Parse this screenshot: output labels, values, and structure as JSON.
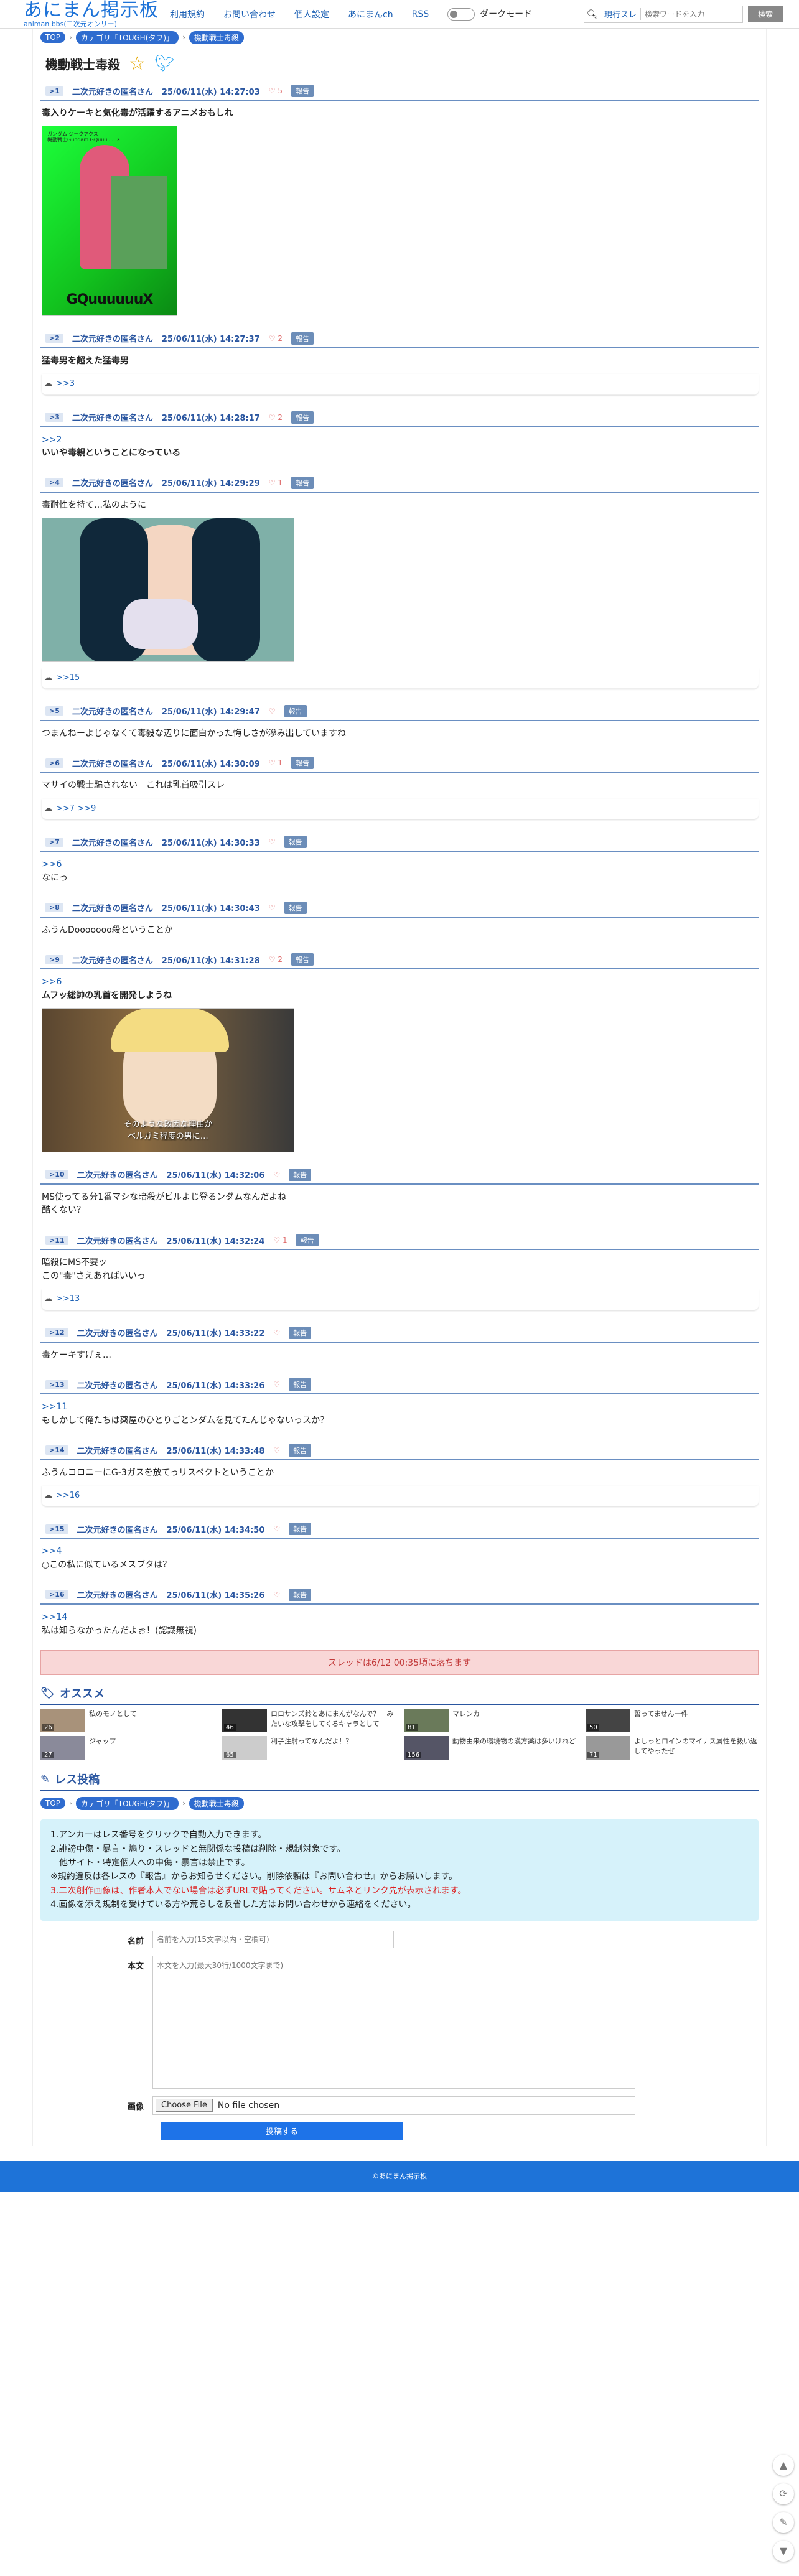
{
  "header": {
    "logo_title": "あにまん掲示板",
    "logo_sub": "animan bbs(二次元オンリー)",
    "nav": [
      "利用規約",
      "お問い合わせ",
      "個人設定",
      "あにまんch",
      "RSS"
    ],
    "dark_mode": "ダークモード",
    "search_type": "現行スレ",
    "search_placeholder": "検索ワードを入力",
    "search_button": "検索"
  },
  "breadcrumb": [
    "TOP",
    "カテゴリ「TOUGH(タフ)」",
    "機動戦士毒殺"
  ],
  "thread_title": "機動戦士毒殺",
  "posts": [
    {
      "num": ">1",
      "name": "二次元好きの匿名さん",
      "date": "25/06/11(水) 14:27:03",
      "likes": "5",
      "report": "報告",
      "lines": [
        "毒入りケーキと気化毒が活躍するアニメおもしれ"
      ],
      "bold": true
    },
    {
      "num": ">2",
      "name": "二次元好きの匿名さん",
      "date": "25/06/11(水) 14:27:37",
      "likes": "2",
      "report": "報告",
      "lines": [
        "猛毒男を超えた猛毒男"
      ],
      "bold": true,
      "replies": ">>3"
    },
    {
      "num": ">3",
      "name": "二次元好きの匿名さん",
      "date": "25/06/11(水) 14:28:17",
      "likes": "2",
      "report": "報告",
      "anchor": ">>2",
      "lines": [
        "いいや毒親ということになっている"
      ],
      "bold": true
    },
    {
      "num": ">4",
      "name": "二次元好きの匿名さん",
      "date": "25/06/11(水) 14:29:29",
      "likes": "1",
      "report": "報告",
      "lines": [
        "毒耐性を持て…私のように"
      ],
      "replies": ">>15"
    },
    {
      "num": ">5",
      "name": "二次元好きの匿名さん",
      "date": "25/06/11(水) 14:29:47",
      "likes": "",
      "report": "報告",
      "lines": [
        "つまんねーよじゃなくて毒殺な辺りに面白かった悔しさが滲み出していますね"
      ]
    },
    {
      "num": ">6",
      "name": "二次元好きの匿名さん",
      "date": "25/06/11(水) 14:30:09",
      "likes": "1",
      "report": "報告",
      "lines": [
        "マサイの戦士騙されない　これは乳首吸引スレ"
      ],
      "replies": ">>7  >>9"
    },
    {
      "num": ">7",
      "name": "二次元好きの匿名さん",
      "date": "25/06/11(水) 14:30:33",
      "likes": "",
      "report": "報告",
      "anchor": ">>6",
      "lines": [
        "なにっ"
      ]
    },
    {
      "num": ">8",
      "name": "二次元好きの匿名さん",
      "date": "25/06/11(水) 14:30:43",
      "likes": "",
      "report": "報告",
      "lines": [
        "ふうんDooooooo殺ということか"
      ]
    },
    {
      "num": ">9",
      "name": "二次元好きの匿名さん",
      "date": "25/06/11(水) 14:31:28",
      "likes": "2",
      "report": "報告",
      "anchor": ">>6",
      "lines": [
        "ムフッ総帥の乳首を開発しようね"
      ],
      "bold": true
    },
    {
      "num": ">10",
      "name": "二次元好きの匿名さん",
      "date": "25/06/11(水) 14:32:06",
      "likes": "",
      "report": "報告",
      "lines": [
        "MS使ってる分1番マシな暗殺がビルよじ登るンダムなんだよね",
        "酷くない？"
      ]
    },
    {
      "num": ">11",
      "name": "二次元好きの匿名さん",
      "date": "25/06/11(水) 14:32:24",
      "likes": "1",
      "report": "報告",
      "lines": [
        "暗殺にMS不要ッ",
        "この\"毒\"さえあればいいっ"
      ],
      "replies": ">>13"
    },
    {
      "num": ">12",
      "name": "二次元好きの匿名さん",
      "date": "25/06/11(水) 14:33:22",
      "likes": "",
      "report": "報告",
      "lines": [
        "毒ケーキすげぇ…"
      ]
    },
    {
      "num": ">13",
      "name": "二次元好きの匿名さん",
      "date": "25/06/11(水) 14:33:26",
      "likes": "",
      "report": "報告",
      "anchor": ">>11",
      "lines": [
        "もしかして俺たちは薬屋のひとりごとンダムを見てたんじゃないっスか？"
      ]
    },
    {
      "num": ">14",
      "name": "二次元好きの匿名さん",
      "date": "25/06/11(水) 14:33:48",
      "likes": "",
      "report": "報告",
      "lines": [
        "ふうんコロニーにG-3ガスを放てっリスペクトということか"
      ],
      "replies": ">>16"
    },
    {
      "num": ">15",
      "name": "二次元好きの匿名さん",
      "date": "25/06/11(水) 14:34:50",
      "likes": "",
      "report": "報告",
      "anchor": ">>4",
      "lines": [
        "○この私に似ているメスブタは？"
      ]
    },
    {
      "num": ">16",
      "name": "二次元好きの匿名さん",
      "date": "25/06/11(水) 14:35:26",
      "likes": "",
      "report": "報告",
      "anchor": ">>14",
      "lines": [
        "私は知らなかったんだよぉ！(認識無視)"
      ]
    }
  ],
  "image_caption": [
    "そのような敗因な理由か",
    "ベルガミ程度の男に…"
  ],
  "image_text_1": [
    "ガンダム ジークアクス",
    "機動戦士Gundam GQuuuuuuX"
  ],
  "close_notice": "スレッドは6/12 00:35頃に落ちます",
  "recommend_title": "オススメ",
  "recommend": [
    {
      "title": "私のモノとして",
      "count": "26"
    },
    {
      "title": "ロロサンズ鈴とあにまんがなんで？　みたいな攻撃をしてくるキャラとして",
      "count": "46"
    },
    {
      "title": "マレンカ",
      "count": "81"
    },
    {
      "title": "誓ってません一件",
      "count": "50"
    },
    {
      "title": "ジャップ",
      "count": "27"
    },
    {
      "title": "利子注射ってなんだよ！？",
      "count": "65"
    },
    {
      "title": "動物由来の環境物の漢方薬は多いけれど",
      "count": "156"
    },
    {
      "title": "よしっとロインのマイナス属性を扱い返してやったぜ",
      "count": "71"
    }
  ],
  "post_form": {
    "title": "レス投稿",
    "notes": [
      "1.アンカーはレス番号をクリックで自動入力できます。",
      "2.誹謗中傷・暴言・煽り・スレッドと無関係な投稿は削除・規制対象です。",
      "　他サイト・特定個人への中傷・暴言は禁止です。",
      "※規約違反は各レスの『報告』からお知らせください。削除依頼は『お問い合わせ』からお願いします。",
      "3.二次創作画像は、作者本人でない場合は必ずURLで貼ってください。サムネとリンク先が表示されます。",
      "4.画像を添え規制を受けている方や荒らしを反省した方はお問い合わせから連絡をください。"
    ],
    "name_label": "名前",
    "name_placeholder": "名前を入力(15文字以内・空欄可)",
    "body_label": "本文",
    "body_placeholder": "本文を入力(最大30行/1000文字まで)",
    "image_label": "画像",
    "file_button": "Choose File",
    "file_status": "No file chosen",
    "submit": "投稿する"
  },
  "footer": "©あにまん掲示板"
}
